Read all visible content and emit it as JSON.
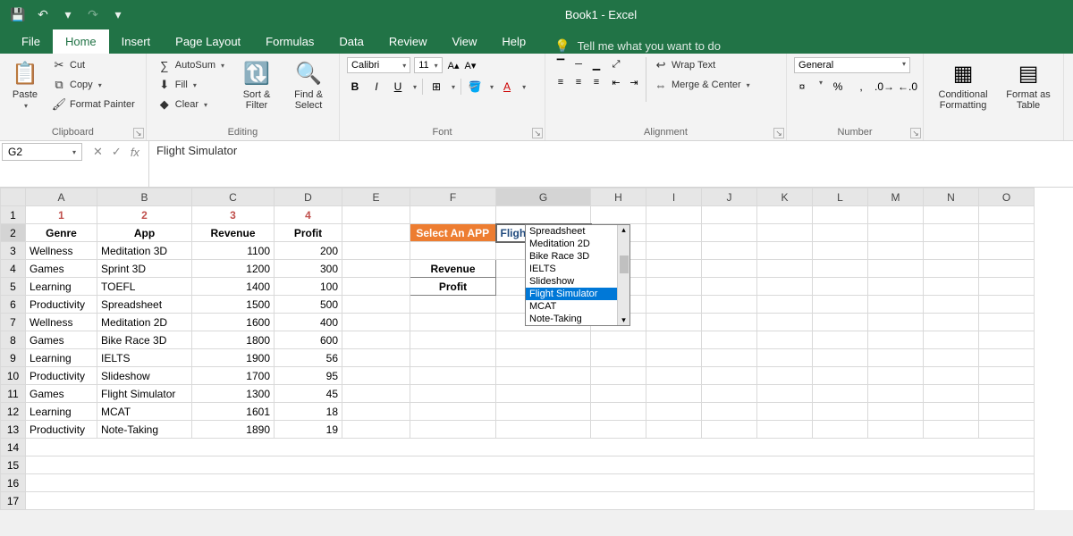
{
  "app_title": "Book1 - Excel",
  "qat": {
    "save": "💾",
    "undo": "↶",
    "redo": "↷",
    "custom": "▾"
  },
  "tabs": [
    "File",
    "Home",
    "Insert",
    "Page Layout",
    "Formulas",
    "Data",
    "Review",
    "View",
    "Help"
  ],
  "active_tab": "Home",
  "tellme": "Tell me what you want to do",
  "ribbon": {
    "clipboard": {
      "label": "Clipboard",
      "paste": "Paste",
      "cut": "Cut",
      "copy": "Copy",
      "format_painter": "Format Painter"
    },
    "editing": {
      "label": "Editing",
      "autosum": "AutoSum",
      "fill": "Fill",
      "clear": "Clear",
      "sort_filter": "Sort & Filter",
      "find_select": "Find & Select"
    },
    "font": {
      "label": "Font",
      "name": "Calibri",
      "size": "11",
      "bold": "B",
      "italic": "I",
      "underline": "U"
    },
    "alignment": {
      "label": "Alignment",
      "wrap": "Wrap Text",
      "merge": "Merge & Center"
    },
    "number": {
      "label": "Number",
      "format": "General",
      "pct": "%",
      "comma": ","
    },
    "styles": {
      "cond_fmt": "Conditional Formatting",
      "fmt_table": "Format as Table"
    }
  },
  "name_box": "G2",
  "formula_value": "Flight Simulator",
  "columns": [
    "A",
    "B",
    "C",
    "D",
    "E",
    "F",
    "G",
    "H",
    "I",
    "J",
    "K",
    "L",
    "M",
    "N",
    "O"
  ],
  "header_row": {
    "c1": "1",
    "c2": "2",
    "c3": "3",
    "c4": "4"
  },
  "table_header": {
    "genre": "Genre",
    "app": "App",
    "revenue": "Revenue",
    "profit": "Profit"
  },
  "select_app_label": "Select An APP",
  "selected_app": "Flight Simulator",
  "lookup_labels": {
    "revenue": "Revenue",
    "profit": "Profit"
  },
  "rows": [
    {
      "r": 3,
      "genre": "Wellness",
      "app": "Meditation 3D",
      "rev": 1100,
      "profit": 200
    },
    {
      "r": 4,
      "genre": "Games",
      "app": "Sprint 3D",
      "rev": 1200,
      "profit": 300
    },
    {
      "r": 5,
      "genre": "Learning",
      "app": "TOEFL",
      "rev": 1400,
      "profit": 100
    },
    {
      "r": 6,
      "genre": "Productivity",
      "app": "Spreadsheet",
      "rev": 1500,
      "profit": 500
    },
    {
      "r": 7,
      "genre": "Wellness",
      "app": "Meditation 2D",
      "rev": 1600,
      "profit": 400
    },
    {
      "r": 8,
      "genre": "Games",
      "app": "Bike Race 3D",
      "rev": 1800,
      "profit": 600
    },
    {
      "r": 9,
      "genre": "Learning",
      "app": "IELTS",
      "rev": 1900,
      "profit": 56
    },
    {
      "r": 10,
      "genre": "Productivity",
      "app": "Slideshow",
      "rev": 1700,
      "profit": 95
    },
    {
      "r": 11,
      "genre": "Games",
      "app": "Flight Simulator",
      "rev": 1300,
      "profit": 45
    },
    {
      "r": 12,
      "genre": "Learning",
      "app": "MCAT",
      "rev": 1601,
      "profit": 18
    },
    {
      "r": 13,
      "genre": "Productivity",
      "app": "Note-Taking",
      "rev": 1890,
      "profit": 19
    }
  ],
  "dropdown": {
    "items": [
      "Spreadsheet",
      "Meditation 2D",
      "Bike Race 3D",
      "IELTS",
      "Slideshow",
      "Flight Simulator",
      "MCAT",
      "Note-Taking"
    ],
    "selected": "Flight Simulator"
  }
}
